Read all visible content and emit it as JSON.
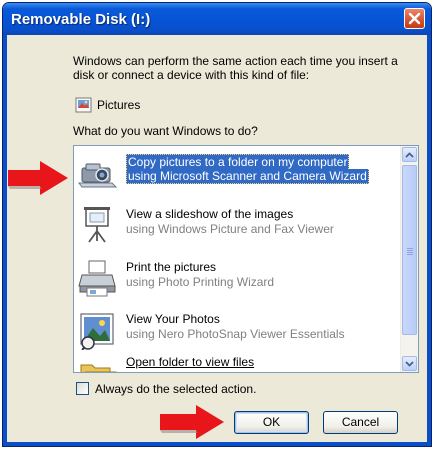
{
  "window": {
    "title": "Removable Disk (I:)",
    "close_icon": "close-x-icon"
  },
  "intro_text": "Windows can perform the same action each time you insert a disk or connect a device with this kind of file:",
  "content_type": {
    "icon": "pictures-icon",
    "label": "Pictures"
  },
  "question": "What do you want Windows to do?",
  "actions": [
    {
      "icon": "scanner-camera-icon",
      "label": "Copy pictures to a folder on my computer",
      "sublabel": "using Microsoft Scanner and Camera Wizard",
      "selected": true
    },
    {
      "icon": "slideshow-projector-icon",
      "label": "View a slideshow of the images",
      "sublabel": "using Windows Picture and Fax Viewer",
      "selected": false
    },
    {
      "icon": "printer-icon",
      "label": "Print the pictures",
      "sublabel": "using Photo Printing Wizard",
      "selected": false
    },
    {
      "icon": "photo-viewer-icon",
      "label": "View Your Photos",
      "sublabel": "using Nero PhotoSnap Viewer Essentials",
      "selected": false
    },
    {
      "icon": "open-folder-icon",
      "label": "Open folder to view files",
      "sublabel": "",
      "selected": false
    }
  ],
  "always_checkbox": {
    "label": "Always do the selected action.",
    "checked": false
  },
  "buttons": {
    "ok": "OK",
    "cancel": "Cancel"
  },
  "annotations": {
    "arrow_color": "#e8151b"
  }
}
